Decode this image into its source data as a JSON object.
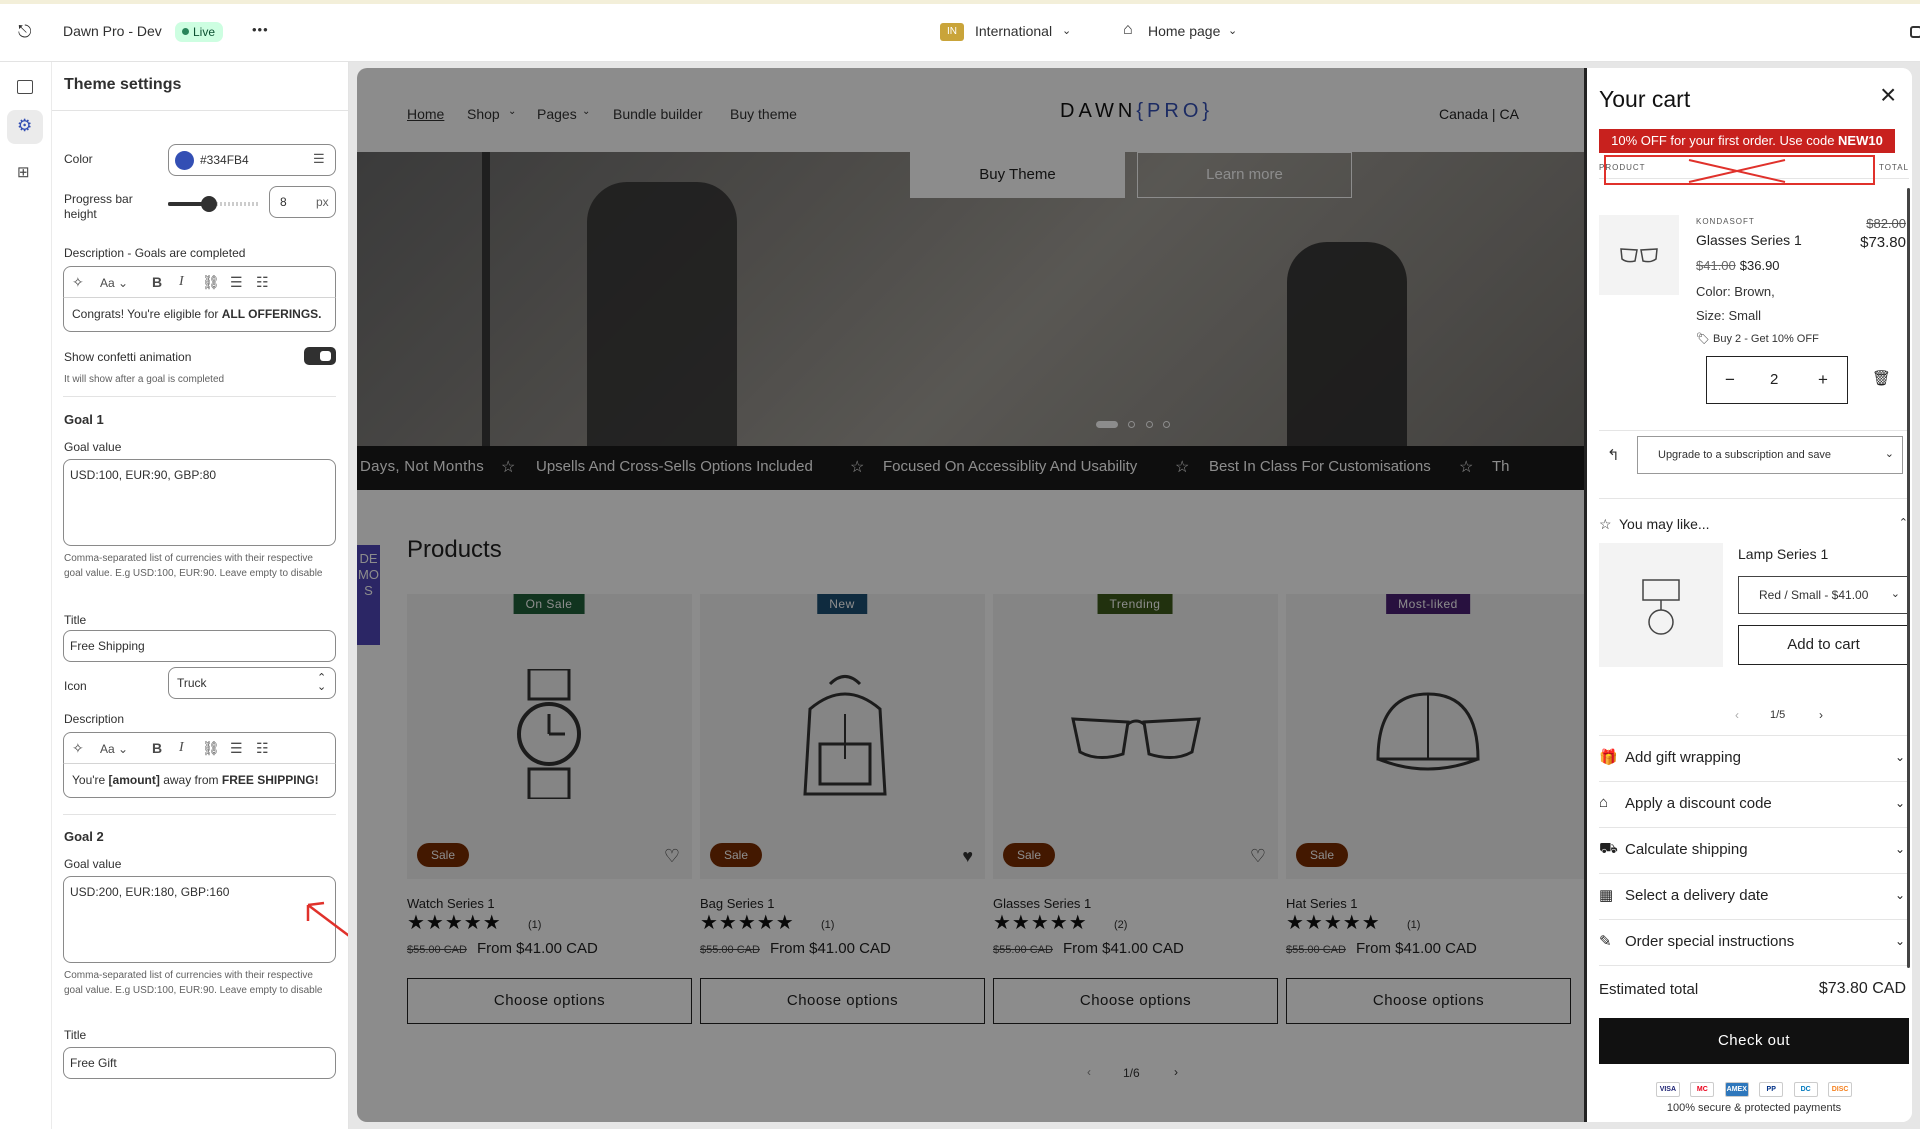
{
  "topbar": {
    "store_name": "Dawn Pro - Dev",
    "live_badge": "Live",
    "more": "•••",
    "market_flag": "IN",
    "market": "International",
    "page": "Home page"
  },
  "panel": {
    "title": "Theme settings",
    "color_label": "Color",
    "color_value": "#334FB4",
    "progress_label": "Progress bar height",
    "progress_value": "8",
    "progress_unit": "px",
    "progress_level": 0.45,
    "desc_goals_label": "Description - Goals are completed",
    "desc_goals_text_pre": "Congrats! You're eligible for ",
    "desc_goals_text_bold": "ALL OFFERINGS.",
    "confetti_label": "Show confetti animation",
    "confetti_help": "It will show after a goal is completed",
    "goal1": {
      "heading": "Goal 1",
      "value_label": "Goal value",
      "value": "USD:100, EUR:90, GBP:80",
      "help": "Comma-separated list of currencies with their respective goal value. E.g USD:100, EUR:90. Leave empty to disable",
      "title_label": "Title",
      "title": "Free Shipping",
      "icon_label": "Icon",
      "icon": "Truck",
      "desc_label": "Description",
      "desc_pre": "You're ",
      "desc_bold1": "[amount]",
      "desc_mid": " away from ",
      "desc_bold2": "FREE SHIPPING!"
    },
    "goal2": {
      "heading": "Goal 2",
      "value_label": "Goal value",
      "value": "USD:200, EUR:180, GBP:160",
      "help": "Comma-separated list of currencies with their respective goal value. E.g USD:100, EUR:90. Leave empty to disable",
      "title_label": "Title",
      "title": "Free Gift"
    }
  },
  "store": {
    "nav": [
      "Home",
      "Shop",
      "Pages",
      "Bundle builder",
      "Buy theme"
    ],
    "logo": "DAWN",
    "logo_accent": "{PRO}",
    "locale": "Canada | CA",
    "hero_btn1": "Buy Theme",
    "hero_btn2": "Learn more",
    "marquee": [
      "Days, Not Months",
      "Upsells And Cross-Sells Options Included",
      "Focused On Accessiblity And Usability",
      "Best In Class For Customisations",
      "Th"
    ],
    "demos_tab": "DEMOS",
    "products_heading": "Products",
    "pagination": "1/6",
    "products": [
      {
        "badge": "On Sale",
        "badge_color": "#1f5f3a",
        "name": "Watch Series 1",
        "reviews": "(1)",
        "old": "$55.00 CAD",
        "price": "From $41.00 CAD",
        "sale": "Sale",
        "cta": "Choose options",
        "icon": "watch-icon",
        "heart": "♡"
      },
      {
        "badge": "New",
        "badge_color": "#1d4f73",
        "name": "Bag Series 1",
        "reviews": "(1)",
        "old": "$55.00 CAD",
        "price": "From $41.00 CAD",
        "sale": "Sale",
        "cta": "Choose options",
        "icon": "backpack-icon",
        "heart": "♥"
      },
      {
        "badge": "Trending",
        "badge_color": "#3d5a1a",
        "name": "Glasses Series 1",
        "reviews": "(2)",
        "old": "$55.00 CAD",
        "price": "From $41.00 CAD",
        "sale": "Sale",
        "cta": "Choose options",
        "icon": "glasses-icon",
        "heart": "♡"
      },
      {
        "badge": "Most-liked",
        "badge_color": "#4a1f73",
        "name": "Hat Series 1",
        "reviews": "(1)",
        "old": "$55.00 CAD",
        "price": "From $41.00 CAD",
        "sale": "Sale",
        "cta": "Choose options",
        "icon": "cap-icon",
        "heart": ""
      }
    ]
  },
  "cart": {
    "title": "Your cart",
    "promo_pre": "10% OFF for your first order. Use code ",
    "promo_code": "NEW10",
    "col_product": "PRODUCT",
    "col_total": "TOTAL",
    "item": {
      "vendor": "KONDASOFT",
      "name": "Glasses Series 1",
      "old_price": "$41.00",
      "price": "$36.90",
      "color": "Color: Brown,",
      "size": "Size: Small",
      "discount": "Buy 2 - Get 10% OFF",
      "qty": "2",
      "line_old": "$82.00",
      "line_total": "$73.80"
    },
    "subscription": "Upgrade to a subscription and save",
    "upsell_heading": "You may like...",
    "upsell": {
      "name": "Lamp Series 1",
      "variant": "Red / Small - $41.00",
      "add": "Add to cart",
      "pager": "1/5"
    },
    "accordions": [
      "Add gift wrapping",
      "Apply a discount code",
      "Calculate shipping",
      "Select a delivery date",
      "Order special instructions"
    ],
    "estimated_label": "Estimated total",
    "estimated_value": "$73.80 CAD",
    "checkout": "Check out",
    "payments": [
      "VISA",
      "MC",
      "AMEX",
      "PP",
      "DC",
      "DISC"
    ],
    "secure": "100% secure & protected payments"
  },
  "colors": {
    "accent": "#334FB4",
    "annotation": "#e0312b",
    "promo": "#c8211e"
  }
}
